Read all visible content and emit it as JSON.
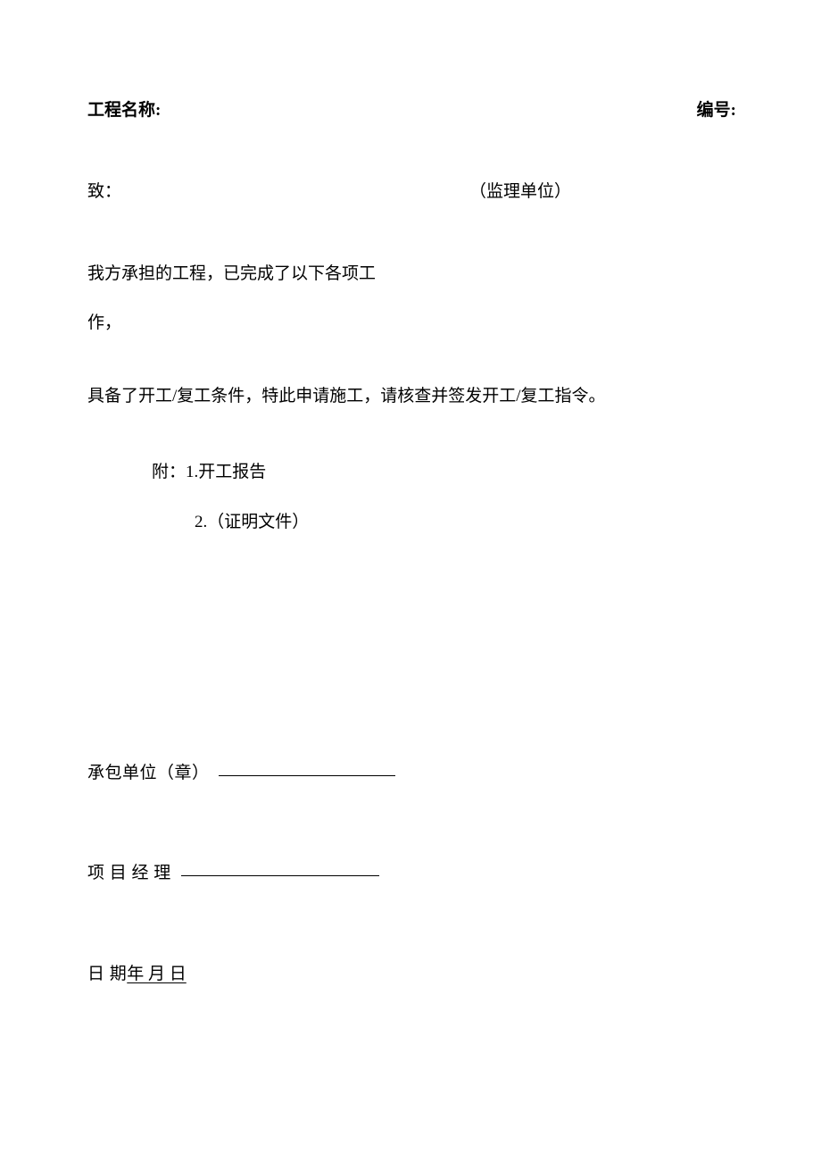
{
  "header": {
    "project_name_label": "工程名称:",
    "serial_label": "编号:"
  },
  "to": {
    "label": "致：",
    "recipient": "（监理单位）"
  },
  "body": {
    "para1": "我方承担的工程，已完成了以下各项工",
    "para2": "作，",
    "para3": "具备了开工/复工条件，特此申请施工，请核查并签发开工/复工指令。"
  },
  "attachments": {
    "line1": "附：1.开工报告",
    "line2": "2.（证明文件）"
  },
  "signatures": {
    "contractor_label": "承包单位（章）",
    "pm_label": "项 目 经 理",
    "date_label": "日 期",
    "date_value": "年 月 日"
  }
}
